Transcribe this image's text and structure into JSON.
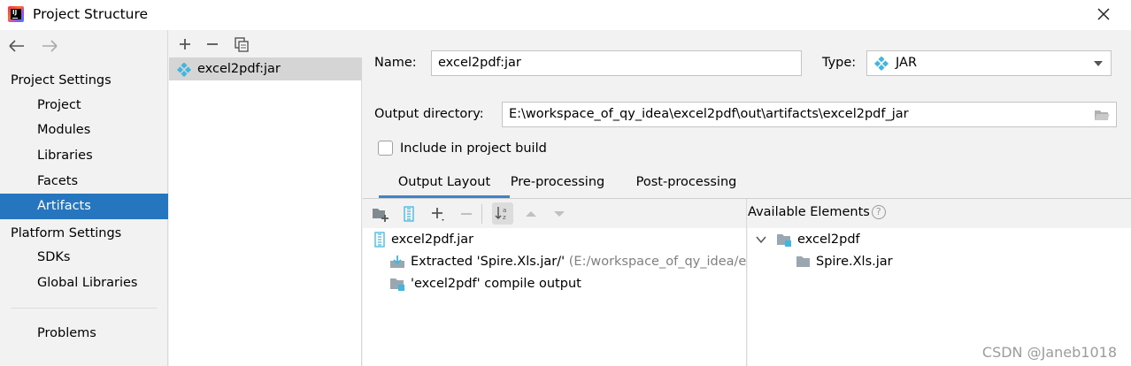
{
  "window": {
    "title": "Project Structure"
  },
  "sidebar": {
    "section_project_settings": "Project Settings",
    "items_project": [
      "Project",
      "Modules",
      "Libraries",
      "Facets",
      "Artifacts"
    ],
    "section_platform_settings": "Platform Settings",
    "items_platform": [
      "SDKs",
      "Global Libraries"
    ],
    "problems": "Problems",
    "selected": "Artifacts"
  },
  "artifacts": {
    "list": [
      "excel2pdf:jar"
    ]
  },
  "form": {
    "name_label": "Name:",
    "name_value": "excel2pdf:jar",
    "type_label": "Type:",
    "type_value": "JAR",
    "output_dir_label": "Output directory:",
    "output_dir_value": "E:\\workspace_of_qy_idea\\excel2pdf\\out\\artifacts\\excel2pdf_jar",
    "include_build_label": "Include in project build",
    "include_build_checked": false
  },
  "tabs": [
    "Output Layout",
    "Pre-processing",
    "Post-processing"
  ],
  "active_tab": "Output Layout",
  "output_layout": {
    "root": "excel2pdf.jar",
    "items": [
      {
        "label": "Extracted 'Spire.Xls.jar/'",
        "detail": "(E:/workspace_of_qy_idea/ex",
        "icon": "extracted-jar-icon"
      },
      {
        "label": "'excel2pdf' compile output",
        "detail": "",
        "icon": "module-output-icon"
      }
    ]
  },
  "available_elements": {
    "title": "Available Elements",
    "help": "?",
    "tree": [
      {
        "label": "excel2pdf",
        "icon": "module-folder-icon",
        "expanded": true
      },
      {
        "label": "Spire.Xls.jar",
        "icon": "library-folder-icon"
      }
    ]
  },
  "watermark": "CSDN @Janeb1018",
  "colors": {
    "selection": "#2675bf",
    "tab_underline": "#4083c9",
    "jar_icon": "#40b6e0"
  }
}
